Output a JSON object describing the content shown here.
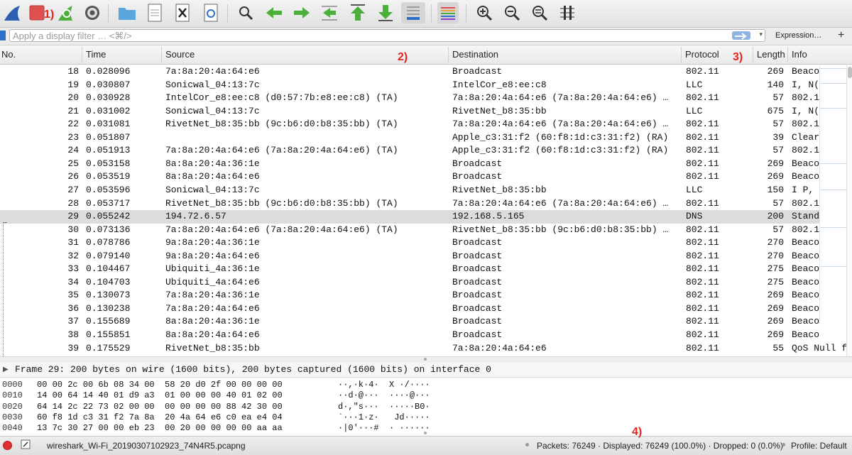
{
  "toolbar": {
    "icons": [
      "shark-fin-icon",
      "stop-capture-icon",
      "restart-capture-icon",
      "options-gear-icon",
      "open-folder-icon",
      "save-file-icon",
      "close-file-icon",
      "reload-icon",
      "find-icon",
      "go-back-icon",
      "go-forward-icon",
      "go-to-packet-icon",
      "go-first-icon",
      "go-last-icon",
      "autoscroll-icon",
      "colorize-icon",
      "zoom-in-icon",
      "zoom-out-icon",
      "zoom-normal-icon",
      "resize-columns-icon"
    ],
    "annotation_1": "1)"
  },
  "filter": {
    "placeholder": "Apply a display filter … <⌘/>",
    "expression_label": "Expression…",
    "add_label": "+"
  },
  "columns": {
    "no": "No.",
    "time": "Time",
    "source": "Source",
    "destination": "Destination",
    "protocol": "Protocol",
    "length": "Length",
    "info": "Info"
  },
  "annotations": {
    "a2": "2)",
    "a3": "3)",
    "a4": "4)"
  },
  "packets": [
    {
      "no": "18",
      "time": "0.028096",
      "src": "7a:8a:20:4a:64:e6",
      "dst": "Broadcast",
      "proto": "802.11",
      "len": "269",
      "info": "Beaco"
    },
    {
      "no": "19",
      "time": "0.030807",
      "src": "Sonicwal_04:13:7c",
      "dst": "IntelCor_e8:ee:c8",
      "proto": "LLC",
      "len": "140",
      "info": "I, N("
    },
    {
      "no": "20",
      "time": "0.030928",
      "src": "IntelCor_e8:ee:c8 (d0:57:7b:e8:ee:c8) (TA)",
      "dst": "7a:8a:20:4a:64:e6 (7a:8a:20:4a:64:e6) …",
      "proto": "802.11",
      "len": "57",
      "info": "802.1"
    },
    {
      "no": "21",
      "time": "0.031002",
      "src": "Sonicwal_04:13:7c",
      "dst": "RivetNet_b8:35:bb",
      "proto": "LLC",
      "len": "675",
      "info": "I, N("
    },
    {
      "no": "22",
      "time": "0.031081",
      "src": "RivetNet_b8:35:bb (9c:b6:d0:b8:35:bb) (TA)",
      "dst": "7a:8a:20:4a:64:e6 (7a:8a:20:4a:64:e6) …",
      "proto": "802.11",
      "len": "57",
      "info": "802.1"
    },
    {
      "no": "23",
      "time": "0.051807",
      "src": "",
      "dst": "Apple_c3:31:f2 (60:f8:1d:c3:31:f2) (RA)",
      "proto": "802.11",
      "len": "39",
      "info": "Clear"
    },
    {
      "no": "24",
      "time": "0.051913",
      "src": "7a:8a:20:4a:64:e6 (7a:8a:20:4a:64:e6) (TA)",
      "dst": "Apple_c3:31:f2 (60:f8:1d:c3:31:f2) (RA)",
      "proto": "802.11",
      "len": "57",
      "info": "802.1"
    },
    {
      "no": "25",
      "time": "0.053158",
      "src": "8a:8a:20:4a:36:1e",
      "dst": "Broadcast",
      "proto": "802.11",
      "len": "269",
      "info": "Beaco"
    },
    {
      "no": "26",
      "time": "0.053519",
      "src": "8a:8a:20:4a:64:e6",
      "dst": "Broadcast",
      "proto": "802.11",
      "len": "269",
      "info": "Beaco"
    },
    {
      "no": "27",
      "time": "0.053596",
      "src": "Sonicwal_04:13:7c",
      "dst": "RivetNet_b8:35:bb",
      "proto": "LLC",
      "len": "150",
      "info": "I P,"
    },
    {
      "no": "28",
      "time": "0.053717",
      "src": "RivetNet_b8:35:bb (9c:b6:d0:b8:35:bb) (TA)",
      "dst": "7a:8a:20:4a:64:e6 (7a:8a:20:4a:64:e6) …",
      "proto": "802.11",
      "len": "57",
      "info": "802.1"
    },
    {
      "no": "29",
      "time": "0.055242",
      "src": "194.72.6.57",
      "dst": "192.168.5.165",
      "proto": "DNS",
      "len": "200",
      "info": "Stand"
    },
    {
      "no": "30",
      "time": "0.073136",
      "src": "7a:8a:20:4a:64:e6 (7a:8a:20:4a:64:e6) (TA)",
      "dst": "RivetNet_b8:35:bb (9c:b6:d0:b8:35:bb) …",
      "proto": "802.11",
      "len": "57",
      "info": "802.1"
    },
    {
      "no": "31",
      "time": "0.078786",
      "src": "9a:8a:20:4a:36:1e",
      "dst": "Broadcast",
      "proto": "802.11",
      "len": "270",
      "info": "Beaco"
    },
    {
      "no": "32",
      "time": "0.079140",
      "src": "9a:8a:20:4a:64:e6",
      "dst": "Broadcast",
      "proto": "802.11",
      "len": "270",
      "info": "Beaco"
    },
    {
      "no": "33",
      "time": "0.104467",
      "src": "Ubiquiti_4a:36:1e",
      "dst": "Broadcast",
      "proto": "802.11",
      "len": "275",
      "info": "Beaco"
    },
    {
      "no": "34",
      "time": "0.104703",
      "src": "Ubiquiti_4a:64:e6",
      "dst": "Broadcast",
      "proto": "802.11",
      "len": "275",
      "info": "Beaco"
    },
    {
      "no": "35",
      "time": "0.130073",
      "src": "7a:8a:20:4a:36:1e",
      "dst": "Broadcast",
      "proto": "802.11",
      "len": "269",
      "info": "Beaco"
    },
    {
      "no": "36",
      "time": "0.130238",
      "src": "7a:8a:20:4a:64:e6",
      "dst": "Broadcast",
      "proto": "802.11",
      "len": "269",
      "info": "Beaco"
    },
    {
      "no": "37",
      "time": "0.155689",
      "src": "8a:8a:20:4a:36:1e",
      "dst": "Broadcast",
      "proto": "802.11",
      "len": "269",
      "info": "Beaco"
    },
    {
      "no": "38",
      "time": "0.155851",
      "src": "8a:8a:20:4a:64:e6",
      "dst": "Broadcast",
      "proto": "802.11",
      "len": "269",
      "info": "Beaco"
    },
    {
      "no": "39",
      "time": "0.175529",
      "src": "RivetNet_b8:35:bb",
      "dst": "7a:8a:20:4a:64:e6",
      "proto": "802.11",
      "len": "55",
      "info": "QoS Null fu"
    }
  ],
  "selected_packet": "29",
  "detail": {
    "frame_summary": "Frame 29: 200 bytes on wire (1600 bits), 200 bytes captured (1600 bits) on interface 0"
  },
  "hex": [
    {
      "offset": "0000",
      "bytes": "00 00 2c 00 6b 08 34 00  58 20 d0 2f 00 00 00 00",
      "ascii": "··,·k·4·  X ·/····"
    },
    {
      "offset": "0010",
      "bytes": "14 00 64 14 40 01 d9 a3  01 00 00 00 40 01 02 00",
      "ascii": "··d·@···  ····@···"
    },
    {
      "offset": "0020",
      "bytes": "64 14 2c 22 73 02 00 00  00 00 00 00 88 42 30 00",
      "ascii": "d·,\"s···  ·····B0·"
    },
    {
      "offset": "0030",
      "bytes": "60 f8 1d c3 31 f2 7a 8a  20 4a 64 e6 c0 ea e4 04",
      "ascii": "`···1·z·   Jd·····"
    },
    {
      "offset": "0040",
      "bytes": "13 7c 30 27 00 00 eb 23  00 20 00 00 00 00 aa aa",
      "ascii": "·|0'···#  · ······"
    }
  ],
  "status": {
    "file_name": "wireshark_Wi-Fi_20190307102923_74N4R5.pcapng",
    "packets_summary": "Packets: 76249 · Displayed: 76249 (100.0%) · Dropped: 0 (0.0%)",
    "profile": "Profile: Default"
  },
  "colors": {
    "selected_row": "#dcdcdc",
    "annotation": "#e8231c",
    "stop_red": "#e05050",
    "arrow_green": "#4caf3a",
    "folder_blue": "#5aa7e0"
  }
}
